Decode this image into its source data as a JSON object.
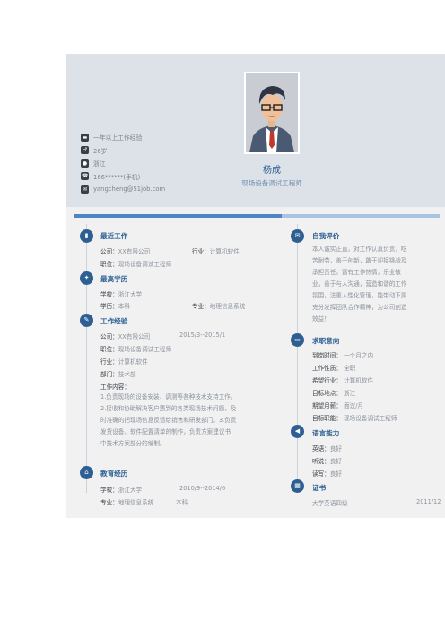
{
  "header": {
    "name": "杨成",
    "title": "现场设备调试工程师",
    "contacts": [
      {
        "icon": "briefcase-icon",
        "text": "一年以上工作经验"
      },
      {
        "icon": "person-icon",
        "text": "26岁"
      },
      {
        "icon": "location-icon",
        "text": "浙江"
      },
      {
        "icon": "phone-icon",
        "text": "166******(手机)"
      },
      {
        "icon": "email-icon",
        "text": "yangcheng@51job.com"
      }
    ]
  },
  "left": {
    "recent_work": {
      "title": "最近工作",
      "company_label": "公司：",
      "company": "XX有限公司",
      "industry_label": "行业：",
      "industry": "计算机软件",
      "position_label": "职位：",
      "position": "现场设备调试工程师"
    },
    "education_top": {
      "title": "最高学历",
      "school_label": "学校：",
      "school": "浙江大学",
      "degree_label": "学历：",
      "degree": "本科",
      "major_label": "专业：",
      "major": "地理信息系统"
    },
    "work": {
      "title": "工作经验",
      "company_label": "公司：",
      "company": "XX有限公司",
      "period": "2015/3--2015/1",
      "position_label": "职位：",
      "position": "现场设备调试工程师",
      "industry_label": "行业：",
      "industry": "计算机软件",
      "dept_label": "部门：",
      "dept": "技术部",
      "content_label": "工作内容：",
      "content_lines": [
        "1.负责现场的设备安装、调测等各种技术支持工作。",
        "2.接收和协助解决客户遇到的各类现场技术问题，及",
        "时准确的把现场信息反馈给销售和研发部门。3.负责",
        "发货设备、软件配置清单的制作，负责方案建议书",
        "中技术方案部分的编制。"
      ]
    },
    "education": {
      "title": "教育经历",
      "school_label": "学校：",
      "school": "浙江大学",
      "period": "2010/9--2014/6",
      "major_label": "专业：",
      "major": "地理信息系统",
      "degree": "本科"
    }
  },
  "right": {
    "self": {
      "title": "自我评价",
      "lines": [
        "本人诚实正直，对工作认真负责，吃",
        "苦耐劳，善于创新，敢于迎接挑战及",
        "承担责任。富有工作热情，乐业敬",
        "业，善于与人沟通，营造和谐的工作",
        "氛围，注重人性化管理，能带动下属",
        "充分发挥团队合作精神，为公司创造",
        "效益！"
      ]
    },
    "intent": {
      "title": "求职意向",
      "rows": [
        {
          "k": "到岗时间：",
          "v": "一个月之内"
        },
        {
          "k": "工作性质：",
          "v": "全职"
        },
        {
          "k": "希望行业：",
          "v": "计算机软件"
        },
        {
          "k": "目标地点：",
          "v": "浙江"
        },
        {
          "k": "期望月薪：",
          "v": "面议/月"
        },
        {
          "k": "目标职能：",
          "v": "现场设备调试工程师"
        }
      ]
    },
    "language": {
      "title": "语言能力",
      "rows": [
        {
          "k": "英语：",
          "v": "良好"
        },
        {
          "k": "听说：",
          "v": "良好"
        },
        {
          "k": "读写：",
          "v": "良好"
        }
      ]
    },
    "cert": {
      "title": "证书",
      "name": "大学英语四级",
      "date": "2011/12"
    }
  },
  "colors": {
    "accent": "#2d5f93",
    "band_light": "#a9c4e3",
    "band_dark": "#4e83c4",
    "header_bg": "#dde2e8"
  }
}
